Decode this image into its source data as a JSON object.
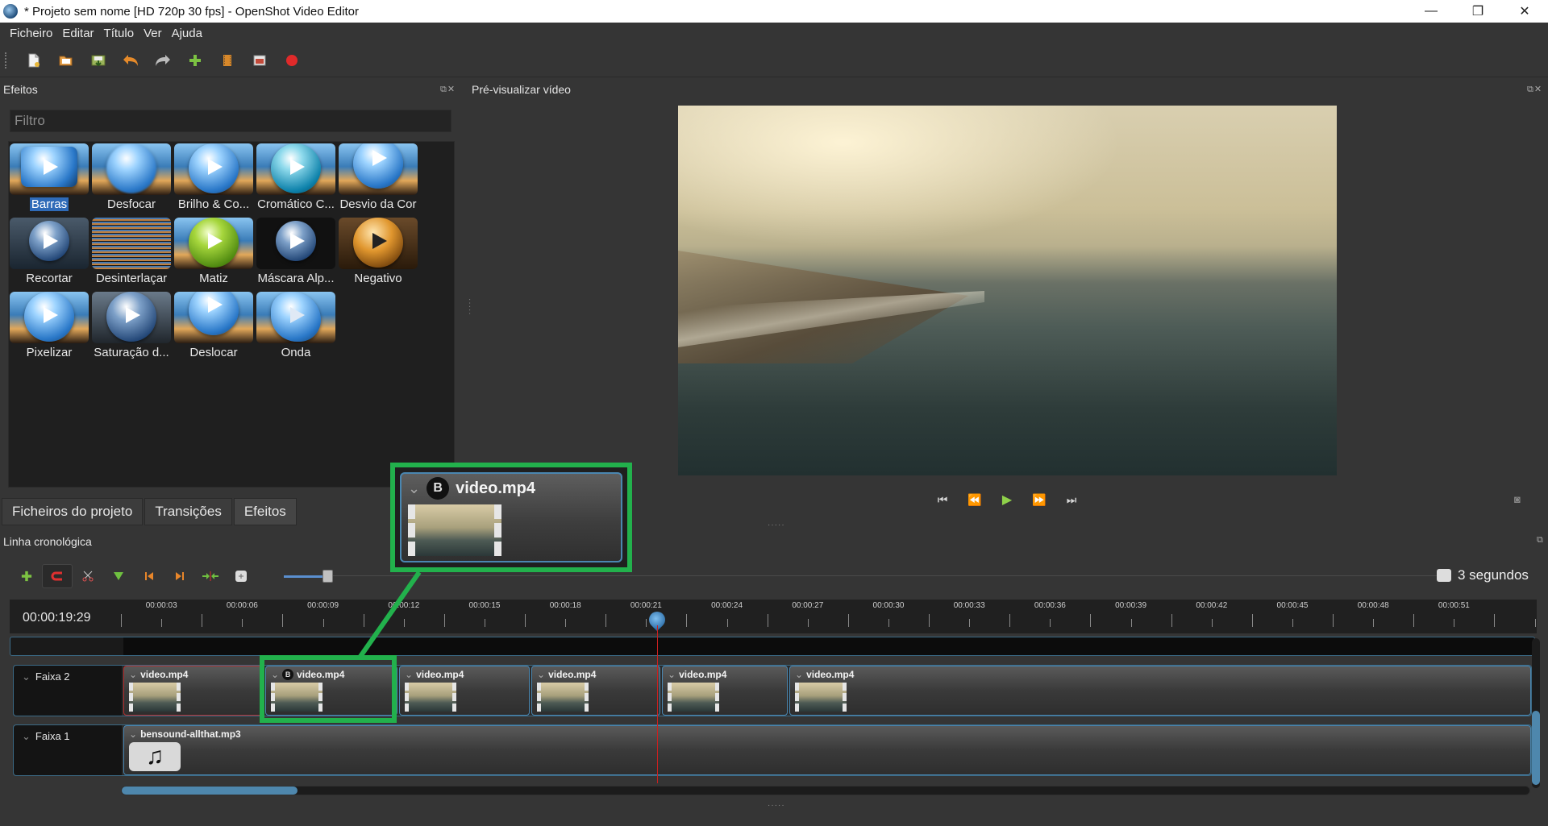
{
  "window": {
    "title": "* Projeto sem nome [HD 720p 30 fps] - OpenShot Video Editor",
    "minimize": "—",
    "maximize": "❐",
    "close": "✕"
  },
  "menu": {
    "items": [
      "Ficheiro",
      "Editar",
      "Título",
      "Ver",
      "Ajuda"
    ]
  },
  "toolbar": {
    "icons": [
      "new-project-icon",
      "open-project-icon",
      "save-project-icon",
      "undo-icon",
      "redo-icon",
      "import-files-icon",
      "profile-icon",
      "fullscreen-icon",
      "export-video-icon"
    ]
  },
  "effects_panel": {
    "title": "Efeitos",
    "filter_placeholder": "Filtro",
    "items": [
      {
        "label": "Barras",
        "selected": true
      },
      {
        "label": "Desfocar"
      },
      {
        "label": "Brilho & Co..."
      },
      {
        "label": "Cromático C..."
      },
      {
        "label": "Desvio da Cor"
      },
      {
        "label": "Recortar"
      },
      {
        "label": "Desinterlaçar"
      },
      {
        "label": "Matiz"
      },
      {
        "label": "Máscara Alp..."
      },
      {
        "label": "Negativo"
      },
      {
        "label": "Pixelizar"
      },
      {
        "label": "Saturação d..."
      },
      {
        "label": "Deslocar"
      },
      {
        "label": "Onda"
      }
    ]
  },
  "tabs": [
    {
      "label": "Ficheiros do projeto"
    },
    {
      "label": "Transições"
    },
    {
      "label": "Efeitos",
      "active": true
    }
  ],
  "preview": {
    "title": "Pré-visualizar vídeo"
  },
  "timeline": {
    "title": "Linha cronológica",
    "zoom_label": "3 segundos",
    "timecode": "00:00:19:29",
    "ruler_labels": [
      "00:00:03",
      "00:00:06",
      "00:00:09",
      "00:00:12",
      "00:00:15",
      "00:00:18",
      "00:00:21",
      "00:00:24",
      "00:00:27",
      "00:00:30",
      "00:00:33",
      "00:00:36",
      "00:00:39",
      "00:00:42",
      "00:00:45",
      "00:00:48",
      "00:00:51"
    ],
    "tracks": [
      {
        "name": "Faixa 2",
        "clips": [
          "video.mp4",
          "video.mp4",
          "video.mp4",
          "video.mp4",
          "video.mp4",
          "video.mp4"
        ]
      },
      {
        "name": "Faixa 1",
        "clips": [
          "bensound-allthat.mp3"
        ]
      }
    ],
    "clip_badge": "B"
  },
  "callout": {
    "clip_name": "video.mp4",
    "badge": "B"
  }
}
